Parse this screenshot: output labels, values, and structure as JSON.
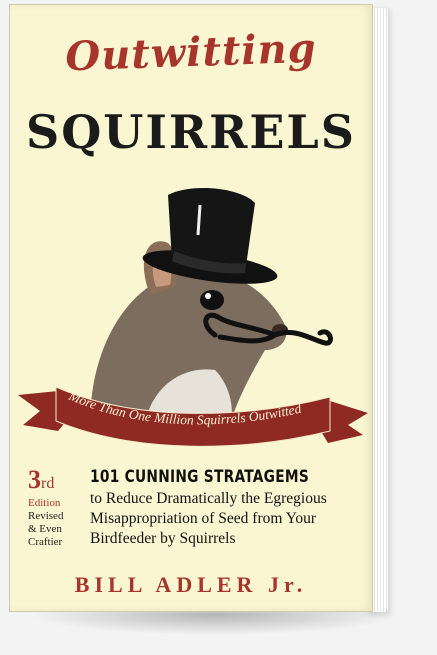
{
  "book": {
    "title_line1": "Outwitting",
    "title_line2": "SQUIRRELS",
    "banner": "More Than One Million Squirrels Outwitted",
    "edition": {
      "number": "3",
      "suffix": "rd",
      "word": "Edition",
      "line1": "Revised",
      "line2": "& Even",
      "line3": "Craftier"
    },
    "subtitle_heading": "101 CUNNING STRATAGEMS",
    "subtitle_lines": [
      "to Reduce Dramatically the Egregious",
      "Misappropriation of Seed from Your",
      "Birdfeeder by Squirrels"
    ],
    "author": "BILL ADLER Jr."
  },
  "colors": {
    "cover": "#fbf6d2",
    "accent_red": "#a8352b",
    "ink": "#1b1b1b",
    "banner": "#8e2a22"
  }
}
